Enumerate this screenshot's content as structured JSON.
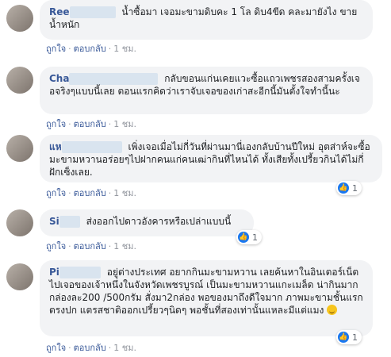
{
  "comments": [
    {
      "name": "Ree",
      "text": "น้ำซื้อมา เจอมะขามดิบคะ 1 โล ดิบ4ขีด คละมายังไง ขายน้ำหนัก",
      "like": "ถูกใจ",
      "reply": "ตอบกลับ",
      "time": "1 ชม.",
      "reactions": null
    },
    {
      "name": "Cha",
      "text": "กลับขอนแก่นเคยแวะซื้อแถวเพชรสองสามครั้งเจอจริงๆแบบนี้เลย ตอนแรกคิดว่าเราจับเจอของเก่าสะอีกนี้มันตั้งใจทำนี้นะ",
      "like": "ถูกใจ",
      "reply": "ตอบกลับ",
      "time": "1 ชม.",
      "reactions": null
    },
    {
      "name": "แห",
      "text": "เพิ่งเจอเมื่อไม่กี่วันที่ผ่านมานี่เองกลับบ้านปีใหม่ อุตส่าห์จะซื้อมะขามหวานอร่อยๆไปฝากคนแก่คนเฒ่ากินที่ไหนได้ ทั้งเสียทั้งเปรี้ยวกินได้ไม่กี่ฝักเซ็งเลย.",
      "like": "ถูกใจ",
      "reply": "ตอบกลับ",
      "time": "1 ชม.",
      "reactions": "1"
    },
    {
      "name": "Si",
      "text": "ส่งออกไปดาวอังคารหรือเปล่าแบบนี้",
      "like": "ถูกใจ",
      "reply": "ตอบกลับ",
      "time": "1 ชม.",
      "reactions": "1"
    },
    {
      "name": "Pi",
      "text": "อยู่ต่างประเทศ อยากกินมะขามหวาน เลยค้นหาในอินเตอร์เน็ต ไปเจอของเจ้าหนึ่งในจังหวัดเพชรบูรณ์ เป็นมะขามหวานแกะเมล็ด น่ากินมาก กล่องละ200 /500กรัม สั่งมา2กล่อง พอของมาถึงดีใจมาก ภาพมะขามชั้นแรกตรงปก แตรสชาติออกเปรี้ยวๆนิดๆ พอชั้นที่สองเท่านั้นแหละมีแต่แมง",
      "like": "ถูกใจ",
      "reply": "ตอบกลับ",
      "time": "1 ชม.",
      "reactions": "1"
    }
  ],
  "colors": {
    "name": "#385898",
    "bubble": "#f2f3f5",
    "like": "#1877f2",
    "meta": "#90949c"
  }
}
